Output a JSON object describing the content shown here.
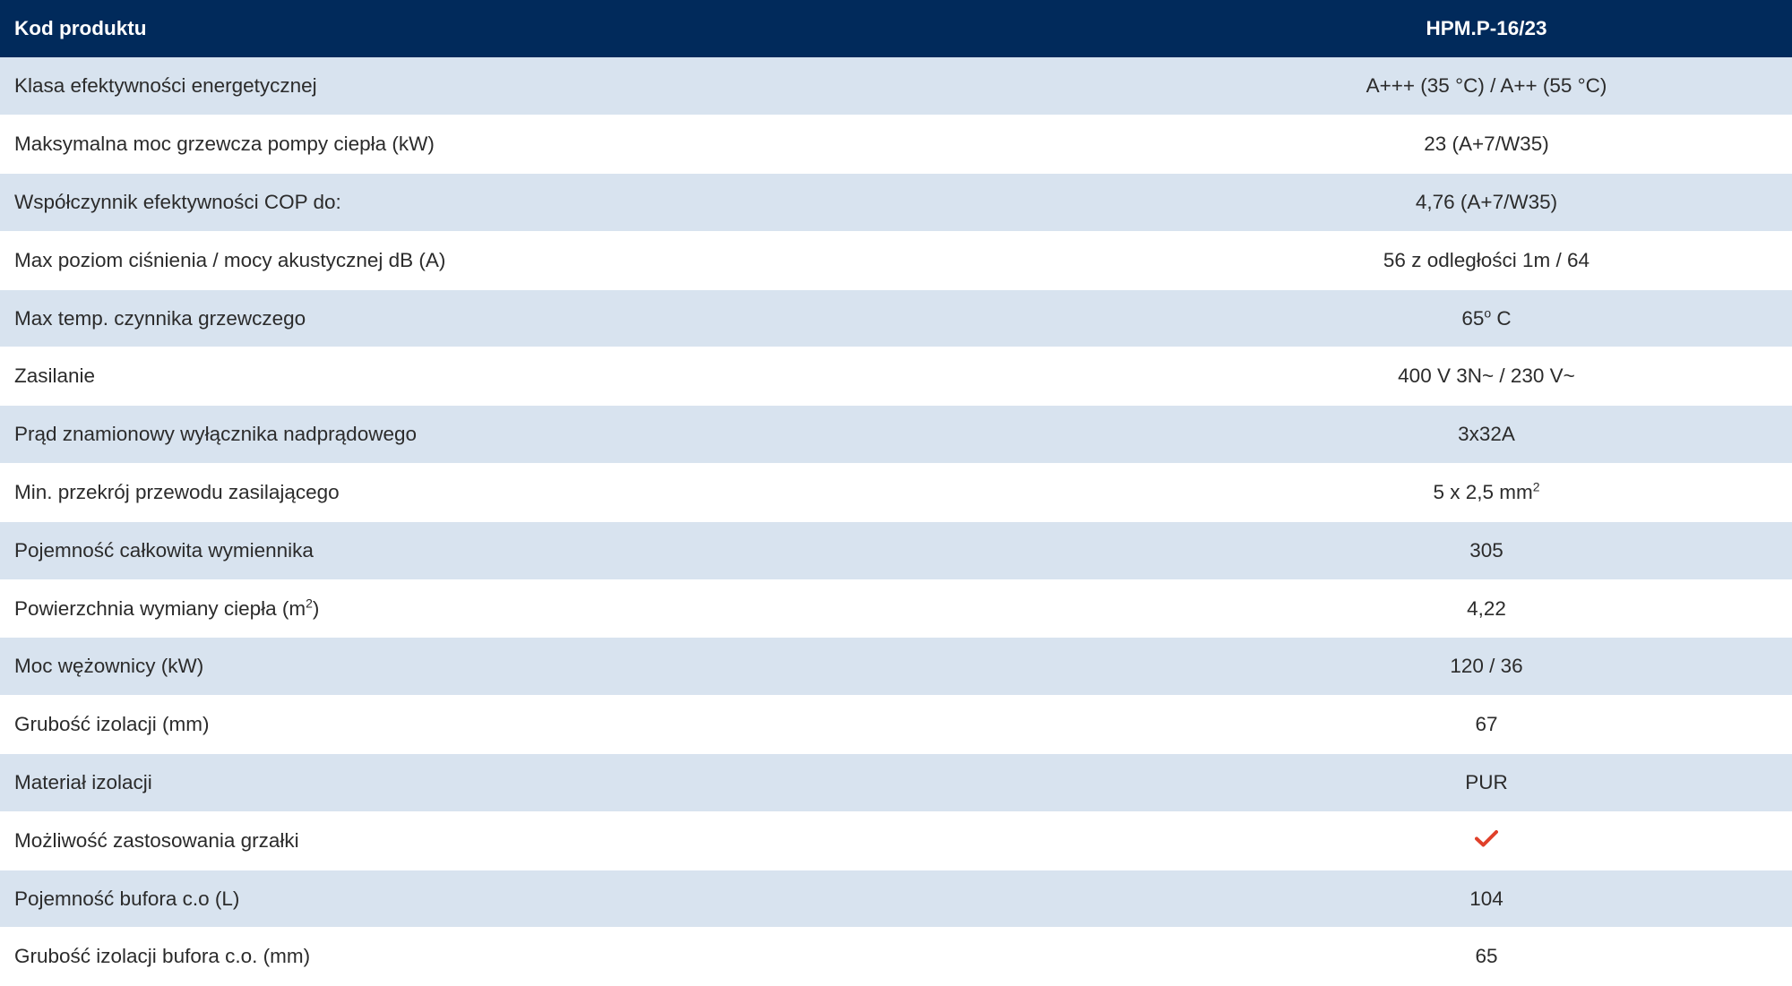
{
  "header": {
    "label": "Kod produktu",
    "value": "HPM.P-16/23"
  },
  "rows": [
    {
      "label": "Klasa efektywności energetycznej",
      "value": "A+++ (35 °C) / A++ (55 °C)"
    },
    {
      "label": "Maksymalna moc grzewcza pompy ciepła (kW)",
      "value": "23 (A+7/W35)"
    },
    {
      "label": "Współczynnik efektywności COP do:",
      "value": "4,76 (A+7/W35)"
    },
    {
      "label": "Max poziom ciśnienia / mocy akustycznej dB (A)",
      "value": "56 z odległości 1m / 64"
    },
    {
      "label": "Max temp. czynnika grzewczego",
      "value": "65",
      "value_sup": "o",
      "value_suffix": " C"
    },
    {
      "label": "Zasilanie",
      "value": "400 V 3N~ / 230 V~"
    },
    {
      "label": "Prąd znamionowy wyłącznika nadprądowego",
      "value": "3x32A"
    },
    {
      "label": "Min. przekrój przewodu zasilającego",
      "value": "5 x 2,5 mm",
      "value_sup": "2"
    },
    {
      "label": "Pojemność całkowita wymiennika",
      "value": "305"
    },
    {
      "label": "Powierzchnia wymiany ciepła (m",
      "label_sup": "2",
      "label_suffix": ")",
      "value": "4,22"
    },
    {
      "label": "Moc wężownicy (kW)",
      "value": "120 / 36"
    },
    {
      "label": "Grubość izolacji (mm)",
      "value": "67"
    },
    {
      "label": "Materiał izolacji",
      "value": "PUR"
    },
    {
      "label": "Możliwość zastosowania grzałki",
      "value_icon": "checkmark-icon",
      "icon_color": "#e0402a"
    },
    {
      "label": "Pojemność bufora c.o (L)",
      "value": "104"
    },
    {
      "label": "Grubość izolacji bufora c.o. (mm)",
      "value": "65"
    }
  ],
  "colors": {
    "header_bg": "#012a5b",
    "row_alt_bg": "#d8e3ef",
    "row_bg": "#ffffff",
    "check": "#e0402a"
  }
}
